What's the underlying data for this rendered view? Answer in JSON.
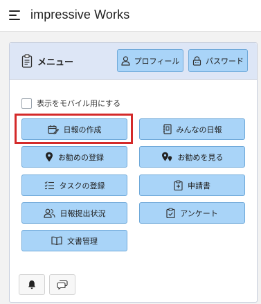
{
  "app": {
    "title": "impressive Works"
  },
  "menu": {
    "title": "メニュー",
    "profile_label": "プロフィール",
    "password_label": "パスワード",
    "mobile_label": "表示をモバイル用にする",
    "mobile_checked": false
  },
  "buttons": [
    {
      "label": "日報の作成",
      "icon": "calendar-edit-icon"
    },
    {
      "label": "みんなの日報",
      "icon": "journal-icon"
    },
    {
      "label": "お勧めの登録",
      "icon": "map-pin-icon"
    },
    {
      "label": "お勧めを見る",
      "icon": "map-pins-icon"
    },
    {
      "label": "タスクの登録",
      "icon": "checklist-icon"
    },
    {
      "label": "申請書",
      "icon": "clipboard-plus-icon"
    },
    {
      "label": "日報提出状況",
      "icon": "people-icon"
    },
    {
      "label": "アンケート",
      "icon": "clipboard-check-icon"
    },
    {
      "label": "文書管理",
      "icon": "book-icon"
    }
  ],
  "footer": {
    "bell_icon": "bell-icon",
    "chat_icon": "chat-icon"
  },
  "colors": {
    "button_bg": "#a9d4f8",
    "button_border": "#6fa9d9",
    "header_bg": "#dde6f6",
    "highlight": "#d42a2a"
  }
}
